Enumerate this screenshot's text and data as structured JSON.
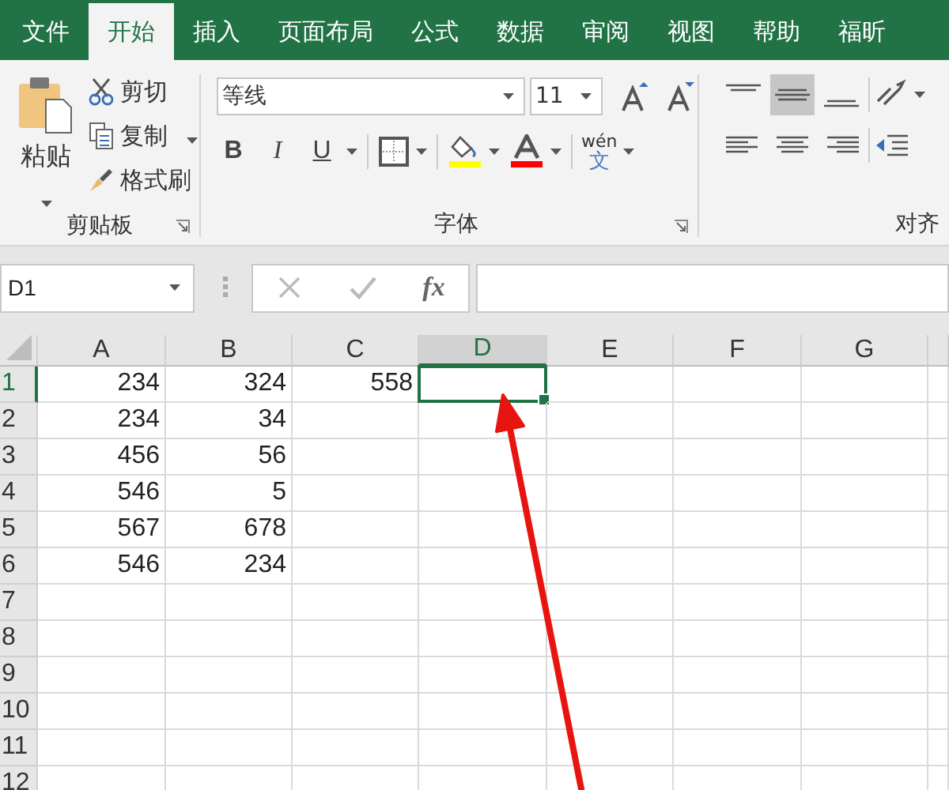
{
  "tabs": [
    {
      "label": "文件",
      "selected": false
    },
    {
      "label": "开始",
      "selected": true
    },
    {
      "label": "插入",
      "selected": false
    },
    {
      "label": "页面布局",
      "selected": false
    },
    {
      "label": "公式",
      "selected": false
    },
    {
      "label": "数据",
      "selected": false
    },
    {
      "label": "审阅",
      "selected": false
    },
    {
      "label": "视图",
      "selected": false
    },
    {
      "label": "帮助",
      "selected": false
    },
    {
      "label": "福昕",
      "selected": false
    }
  ],
  "clipboard": {
    "paste": "粘贴",
    "cut": "剪切",
    "copy": "复制",
    "format_painter": "格式刷",
    "group_label": "剪贴板"
  },
  "font": {
    "name": "等线",
    "size": "11",
    "bold": "B",
    "italic": "I",
    "underline": "U",
    "phonetic_top": "wén",
    "phonetic_bottom": "文",
    "group_label": "字体"
  },
  "alignment": {
    "vertical": [
      {
        "kind": "top",
        "selected": false
      },
      {
        "kind": "middle",
        "selected": true
      },
      {
        "kind": "bottom",
        "selected": false
      }
    ],
    "group_label": "对齐"
  },
  "formula_bar": {
    "name_box": "D1",
    "function_label": "fx"
  },
  "sheet": {
    "columns": [
      {
        "label": "A",
        "selected": false
      },
      {
        "label": "B",
        "selected": false
      },
      {
        "label": "C",
        "selected": false
      },
      {
        "label": "D",
        "selected": true
      },
      {
        "label": "E",
        "selected": false
      },
      {
        "label": "F",
        "selected": false
      },
      {
        "label": "G",
        "selected": false
      }
    ],
    "rows": [
      {
        "label": "1",
        "selected": true,
        "cells": [
          "234",
          "324",
          "558"
        ]
      },
      {
        "label": "2",
        "selected": false,
        "cells": [
          "234",
          "34"
        ]
      },
      {
        "label": "3",
        "selected": false,
        "cells": [
          "456",
          "56"
        ]
      },
      {
        "label": "4",
        "selected": false,
        "cells": [
          "546",
          "5"
        ]
      },
      {
        "label": "5",
        "selected": false,
        "cells": [
          "567",
          "678"
        ]
      },
      {
        "label": "6",
        "selected": false,
        "cells": [
          "546",
          "234"
        ]
      },
      {
        "label": "7",
        "selected": false
      },
      {
        "label": "8",
        "selected": false
      },
      {
        "label": "9",
        "selected": false
      },
      {
        "label": "10",
        "selected": false
      },
      {
        "label": "11",
        "selected": false
      },
      {
        "label": "12",
        "selected": false
      }
    ],
    "annotations": [
      {
        "kind": "arrow"
      }
    ]
  }
}
